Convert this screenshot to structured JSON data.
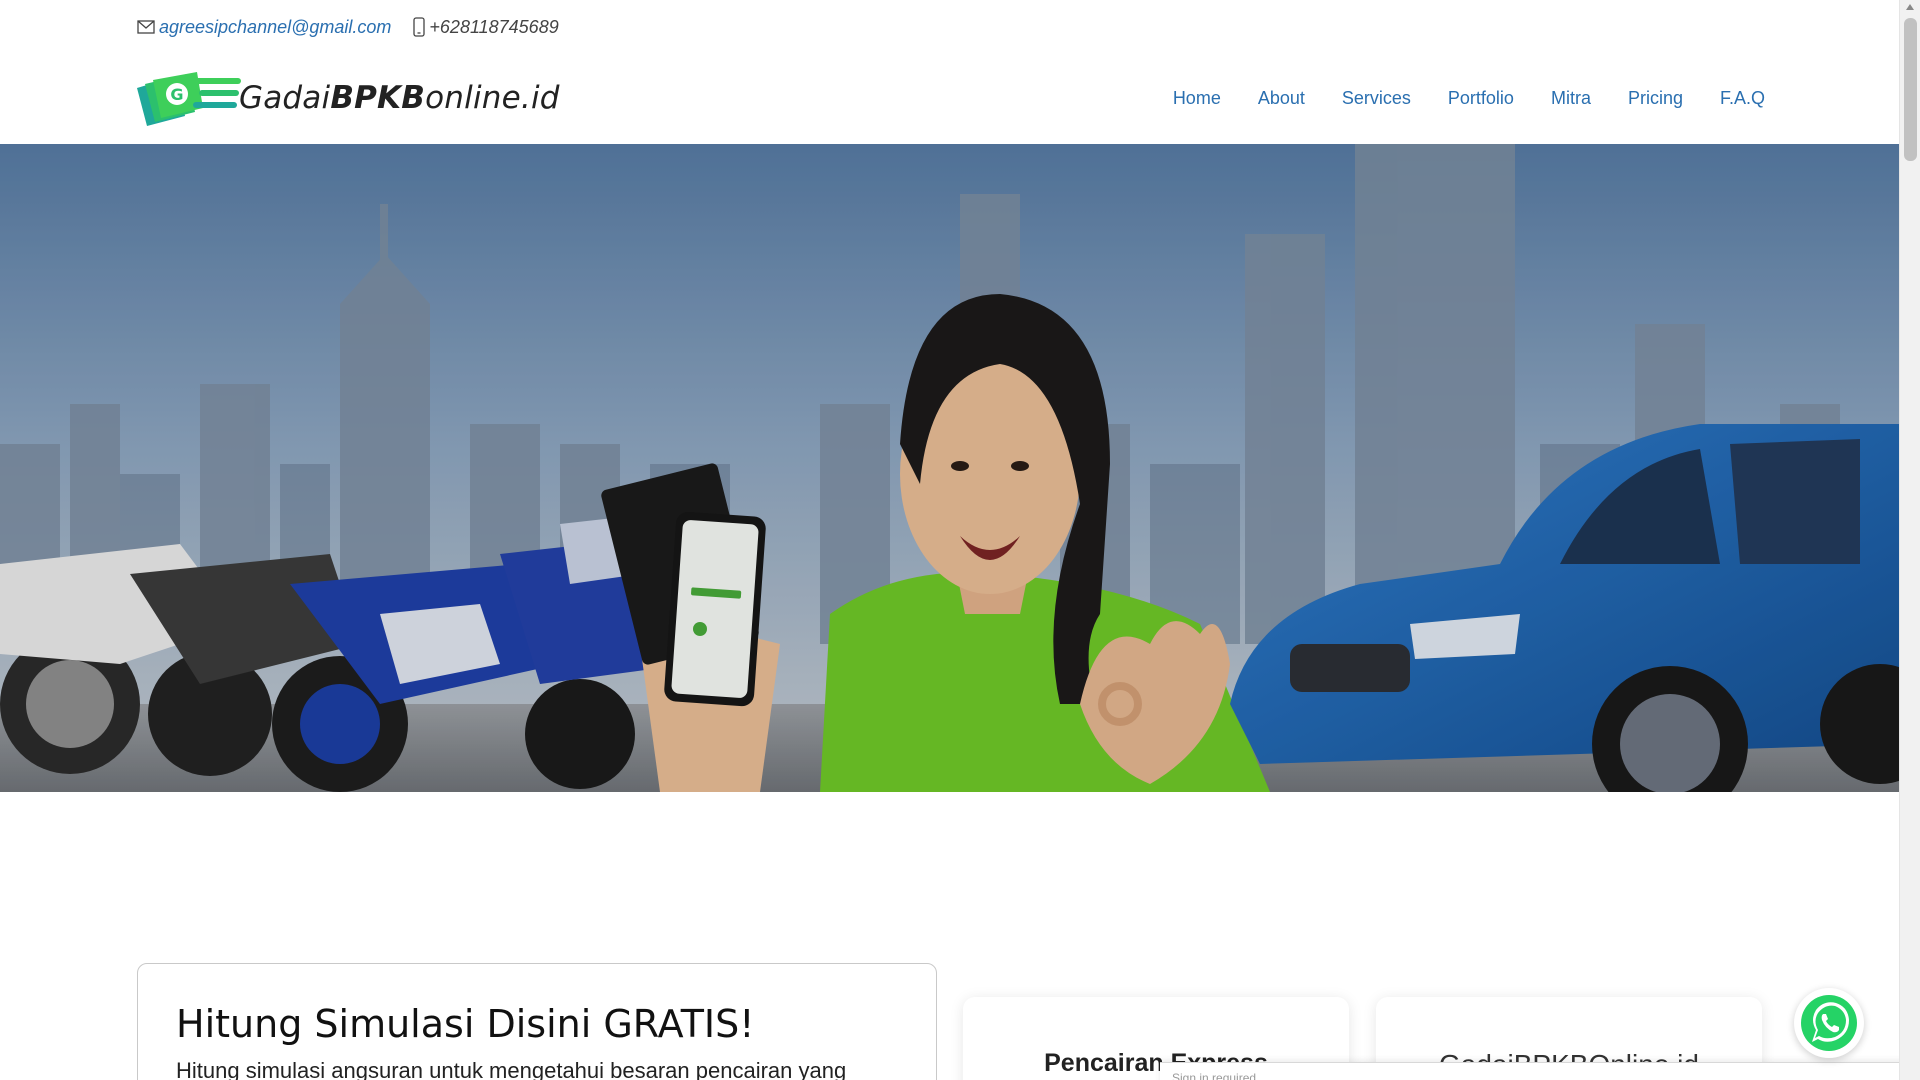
{
  "topbar": {
    "email": "agreesipchannel@gmail.com",
    "phone": "+628118745689"
  },
  "header": {
    "logo_text_regular_1": "Gadai",
    "logo_text_bold": "BPKB",
    "logo_text_regular_2": "online.id",
    "nav": [
      "Home",
      "About",
      "Services",
      "Portfolio",
      "Mitra",
      "Pricing",
      "F.A.Q"
    ]
  },
  "calculator": {
    "title": "Hitung Simulasi Disini GRATIS!",
    "description": "Hitung simulasi angsuran untuk mengetahui besaran pencairan yang"
  },
  "features": [
    {
      "title": "Pencairan Express"
    },
    {
      "title": "GadaiBPKBOnline.id"
    }
  ],
  "signin": {
    "text": "Sign in required"
  },
  "colors": {
    "nav_link": "#2a6fb0",
    "brand_green": "#3ecf5a",
    "brand_teal": "#1fa89a"
  }
}
